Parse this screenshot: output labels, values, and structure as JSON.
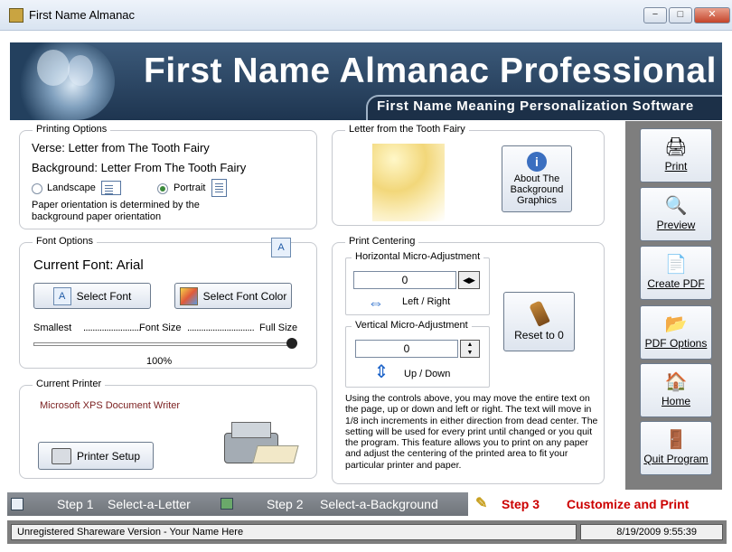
{
  "window": {
    "title": "First Name Almanac",
    "min": "−",
    "max": "□",
    "close": "✕"
  },
  "banner": {
    "title": "First Name Almanac Professional",
    "subtitle": "First Name Meaning Personalization Software"
  },
  "printing": {
    "title": "Printing Options",
    "verse": "Verse:  Letter from The Tooth Fairy",
    "background": "Background:  Letter From The Tooth Fairy",
    "landscape": "Landscape",
    "portrait": "Portrait",
    "note": "Paper orientation is determined by the background paper orientation"
  },
  "letter": {
    "title": "Letter from the Tooth Fairy",
    "about_button": "About The Background Graphics"
  },
  "font": {
    "title": "Font Options",
    "current": "Current Font:  Arial",
    "select_font": "Select Font",
    "select_color": "Select Font Color",
    "scale_left": "Smallest",
    "scale_mid": "Font Size",
    "scale_right": "Full Size",
    "percent": "100%",
    "level": 1.0
  },
  "centering": {
    "title": "Print Centering",
    "horizontal_title": "Horizontal Micro-Adjustment",
    "horizontal_value": "0",
    "horizontal_label": "Left / Right",
    "vertical_title": "Vertical Micro-Adjustment",
    "vertical_value": "0",
    "vertical_label": "Up / Down",
    "reset": "Reset to 0",
    "help": "Using the controls above, you may move the entire text on the page, up or down and left or right. The text will move in 1/8 inch increments in either direction from dead center. The setting will be used for every print until changed or you quit the program.  This feature allows you to print on any paper and adjust the centering of the printed area to fit your particular printer and paper."
  },
  "printer": {
    "title": "Current Printer",
    "name": "Microsoft XPS Document Writer",
    "setup": "Printer Setup"
  },
  "actions": [
    {
      "label": "Print",
      "icon": "printer-icon"
    },
    {
      "label": "Preview",
      "icon": "magnifier-icon"
    },
    {
      "label": "Create PDF",
      "icon": "pdf-icon"
    },
    {
      "label": "PDF Options",
      "icon": "pdf-options-icon"
    },
    {
      "label": "Home",
      "icon": "home-icon"
    },
    {
      "label": "Quit Program",
      "icon": "door-icon"
    }
  ],
  "steps": [
    {
      "num": "Step 1",
      "label": "Select-a-Letter"
    },
    {
      "num": "Step 2",
      "label": "Select-a-Background"
    },
    {
      "num": "Step 3",
      "label": "Customize and Print"
    }
  ],
  "status": {
    "registration": "Unregistered Shareware Version - Your Name Here",
    "datetime": "8/19/2009 9:55:39"
  },
  "colors": {
    "accent_red": "#cc0000",
    "panel_gray": "#7e7e7e",
    "banner_blue": "#2a4565"
  }
}
